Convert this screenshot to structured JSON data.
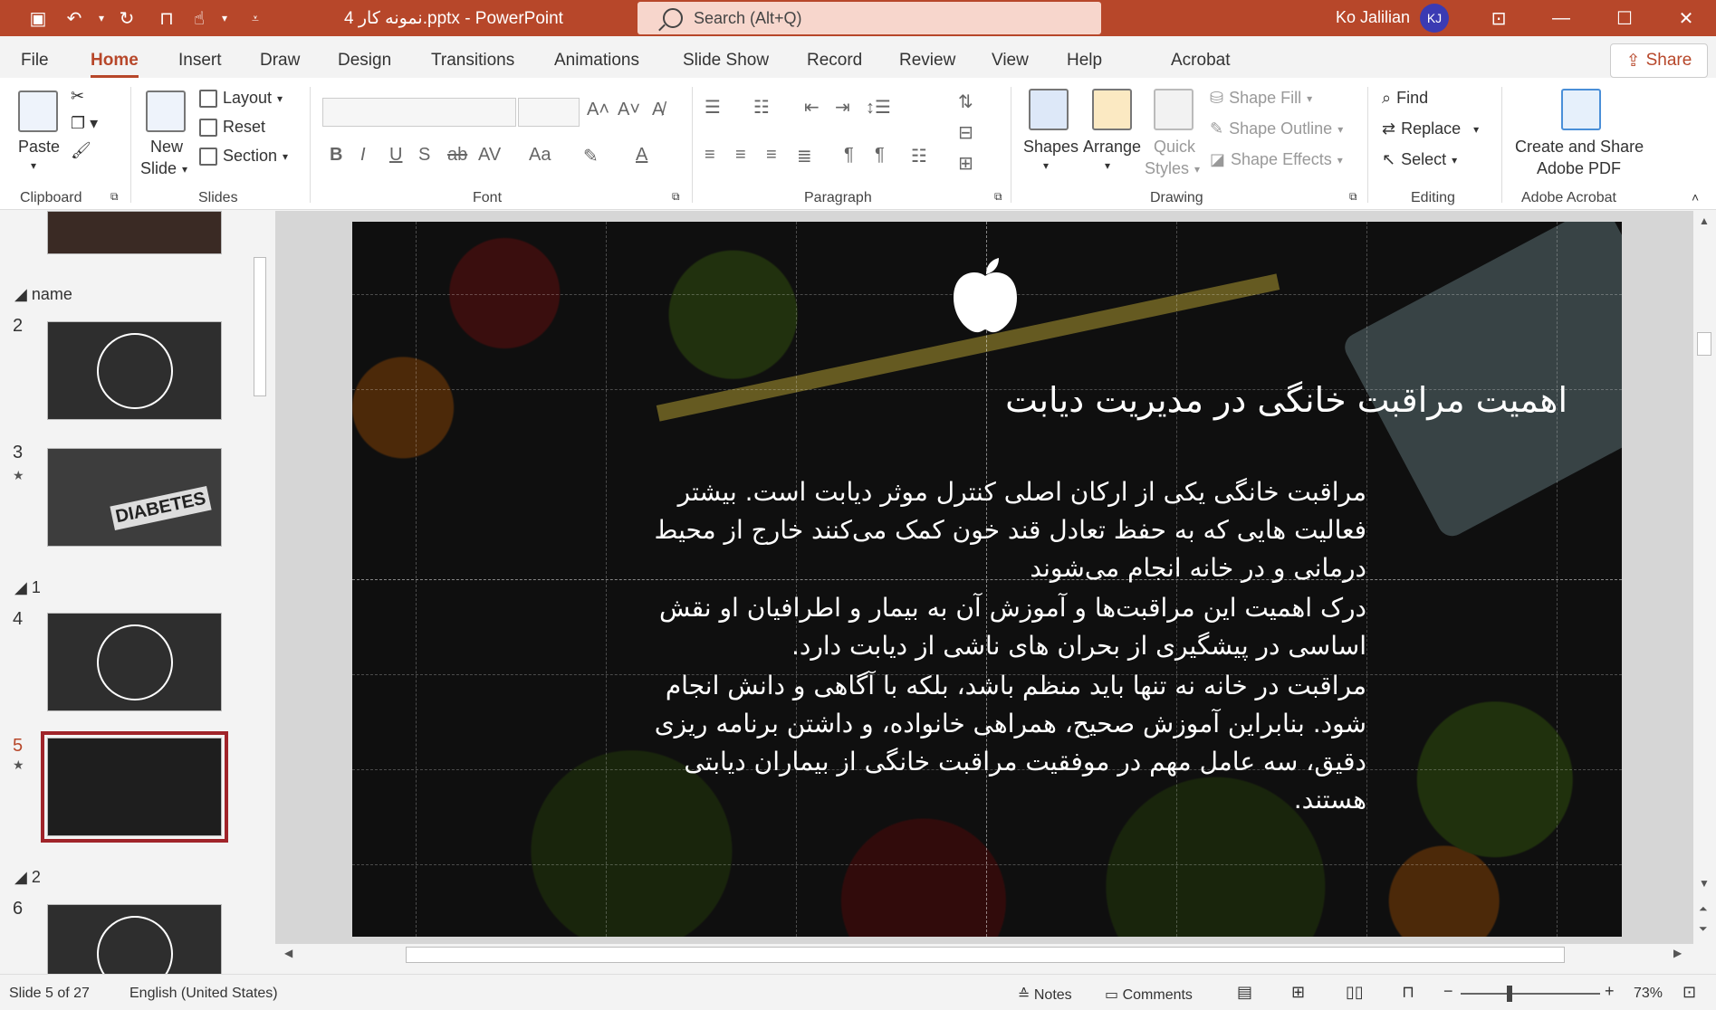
{
  "titlebar": {
    "doc_title": "نمونه کار 4.pptx - PowerPoint",
    "search_placeholder": "Search (Alt+Q)",
    "user_name": "Ko Jalilian",
    "user_initials": "KJ"
  },
  "tabs": [
    {
      "label": "File"
    },
    {
      "label": "Home",
      "active": true
    },
    {
      "label": "Insert"
    },
    {
      "label": "Draw"
    },
    {
      "label": "Design"
    },
    {
      "label": "Transitions"
    },
    {
      "label": "Animations"
    },
    {
      "label": "Slide Show"
    },
    {
      "label": "Record"
    },
    {
      "label": "Review"
    },
    {
      "label": "View"
    },
    {
      "label": "Help"
    },
    {
      "label": "Acrobat"
    }
  ],
  "share_label": "Share",
  "ribbon": {
    "clipboard": {
      "label": "Clipboard",
      "paste": "Paste"
    },
    "slides": {
      "label": "Slides",
      "new_slide_1": "New",
      "new_slide_2": "Slide",
      "layout": "Layout",
      "reset": "Reset",
      "section": "Section"
    },
    "font": {
      "label": "Font",
      "bold": "B",
      "italic": "I",
      "underline": "U",
      "shadow": "S",
      "strike": "ab",
      "spacing": "AV",
      "case": "Aa",
      "color": "A"
    },
    "paragraph": {
      "label": "Paragraph"
    },
    "drawing": {
      "label": "Drawing",
      "shapes": "Shapes",
      "arrange": "Arrange",
      "quick_styles_1": "Quick",
      "quick_styles_2": "Styles",
      "shape_fill": "Shape Fill",
      "shape_outline": "Shape Outline",
      "shape_effects": "Shape Effects"
    },
    "editing": {
      "label": "Editing",
      "find": "Find",
      "replace": "Replace",
      "select": "Select"
    },
    "acrobat": {
      "label": "Adobe Acrobat",
      "create_1": "Create and Share",
      "create_2": "Adobe PDF"
    }
  },
  "thumbnails": {
    "sections": [
      {
        "name": "name"
      },
      {
        "name": "1"
      },
      {
        "name": "2"
      }
    ],
    "slides": [
      {
        "num": "2"
      },
      {
        "num": "3",
        "caption": "DIABETES"
      },
      {
        "num": "4"
      },
      {
        "num": "5",
        "selected": true
      },
      {
        "num": "6"
      }
    ]
  },
  "slide": {
    "title": "اهمیت مراقبت خانگی در مدیریت دیابت",
    "paragraphs": [
      "مراقبت خانگی یکی از ارکان اصلی کنترل موثر دیابت است. بیشتر فعالیت هایی که به حفظ تعادل قند خون کمک می‌کنند خارج از محیط درمانی و در خانه انجام می‌شوند",
      "درک اهمیت این مراقبت‌ها و آموزش آن به بیمار و اطرافیان او نقش اساسی در پیشگیری از بحران های ناشی از دیابت دارد.",
      "مراقبت در خانه نه تنها باید منظم باشد، بلکه با آگاهی و دانش انجام شود. بنابراین آموزش صحیح، همراهی خانواده، و داشتن برنامه ریزی دقیق، سه عامل مهم در موفقیت مراقبت خانگی از بیماران دیابتی هستند."
    ]
  },
  "statusbar": {
    "slide_info": "Slide 5 of 27",
    "language": "English (United States)",
    "notes": "Notes",
    "comments": "Comments",
    "zoom_minus": "−",
    "zoom_plus": "+",
    "zoom": "73%"
  },
  "colors": {
    "accent": "#b7472a",
    "selected_thumb": "#a0242a",
    "user_avatar": "#3b3bb3"
  }
}
